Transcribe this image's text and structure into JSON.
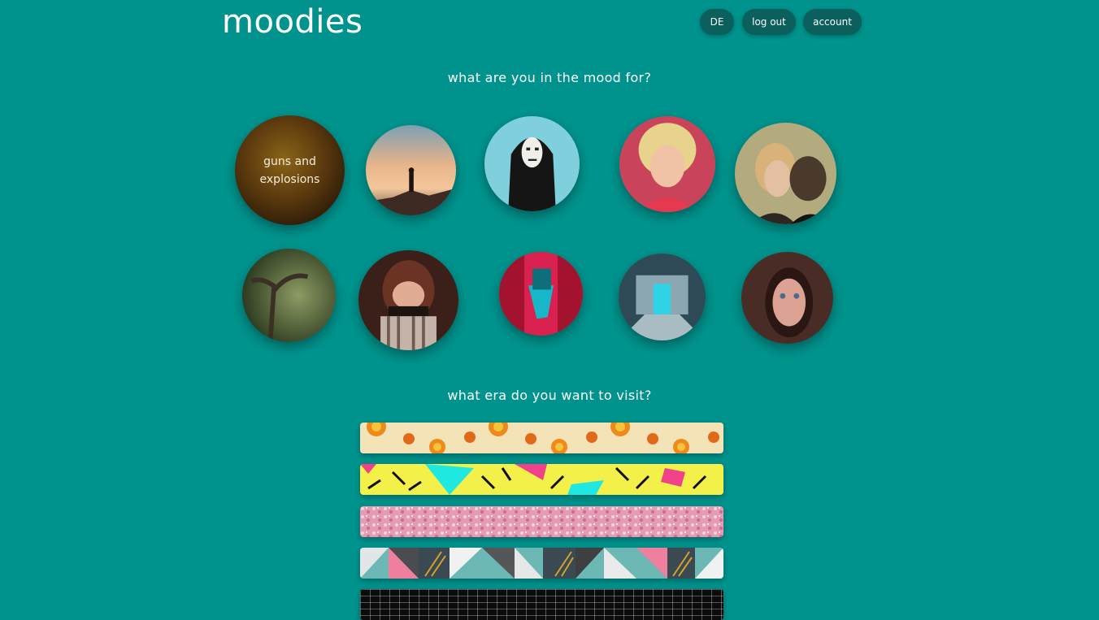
{
  "header": {
    "logo": "moodies",
    "lang_button": "DE",
    "logout_button": "log out",
    "account_button": "account"
  },
  "mood_section": {
    "heading": "what are you in the mood for?",
    "moods": [
      {
        "label": "guns and\nexplosions",
        "icon": "action-image"
      },
      {
        "label": "",
        "icon": "mountain-adventure-image"
      },
      {
        "label": "",
        "icon": "no-face-anime-image"
      },
      {
        "label": "",
        "icon": "comedy-blonde-image"
      },
      {
        "label": "",
        "icon": "romance-couple-image"
      },
      {
        "label": "",
        "icon": "forest-fantasy-image"
      },
      {
        "label": "",
        "icon": "horror-scared-image"
      },
      {
        "label": "",
        "icon": "neon-scifi-image"
      },
      {
        "label": "",
        "icon": "space-corridor-image"
      },
      {
        "label": "",
        "icon": "thriller-woman-image"
      }
    ]
  },
  "era_section": {
    "heading": "what era do you want to visit?",
    "eras": [
      {
        "icon": "70s-floral-pattern"
      },
      {
        "icon": "80s-memphis-pattern"
      },
      {
        "icon": "pink-glitter-pattern"
      },
      {
        "icon": "geometric-triangle-pattern"
      },
      {
        "icon": "retro-grid-pattern"
      }
    ]
  },
  "colors": {
    "background": "#00938d",
    "button": "#0b5f5c",
    "text": "#ffffff"
  }
}
